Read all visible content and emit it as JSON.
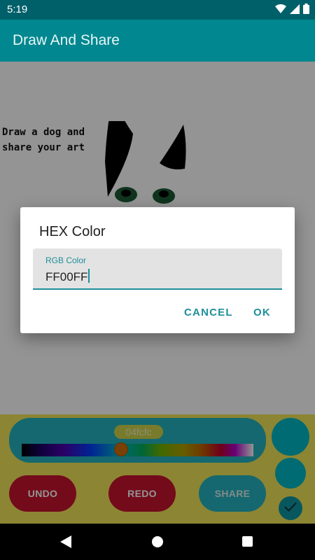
{
  "status_bar": {
    "time": "5:19",
    "icons": [
      "wifi-icon",
      "signal-icon",
      "battery-icon"
    ]
  },
  "app_bar": {
    "title": "Draw And Share"
  },
  "canvas": {
    "prompt": "Draw a dog and share your art"
  },
  "palette": {
    "hex_label": "04fcfc",
    "spectrum_position": 0.43
  },
  "buttons": {
    "undo": "UNDO",
    "redo": "REDO",
    "share": "SHARE"
  },
  "fabs": {
    "check_icon": "check-icon"
  },
  "dialog": {
    "title": "HEX Color",
    "input_label": "RGB Color",
    "input_value": "FF00FF",
    "cancel": "CANCEL",
    "ok": "OK"
  },
  "colors": {
    "accent": "#00878F",
    "teal": "#25B3BF",
    "red": "#C8142F",
    "yellow": "#F2E65A"
  }
}
